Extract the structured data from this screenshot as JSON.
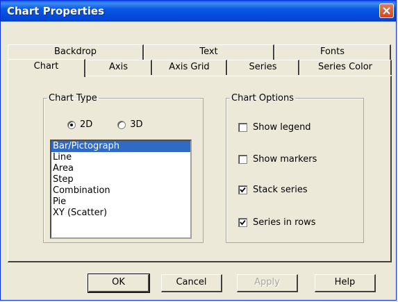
{
  "window": {
    "title": "Chart Properties"
  },
  "tabs_back": [
    "Backdrop",
    "Text",
    "Fonts"
  ],
  "tabs_front": [
    "Chart",
    "Axis",
    "Axis Grid",
    "Series",
    "Series Color"
  ],
  "active_tab": "Chart",
  "chart_type": {
    "legend": "Chart Type",
    "radio_2d": "2D",
    "radio_3d": "3D",
    "selected_dim": "2D",
    "items": [
      "Bar/Pictograph",
      "Line",
      "Area",
      "Step",
      "Combination",
      "Pie",
      "XY (Scatter)"
    ],
    "selected_item": "Bar/Pictograph"
  },
  "chart_options": {
    "legend": "Chart Options",
    "show_legend": {
      "label": "Show legend",
      "checked": false
    },
    "show_markers": {
      "label": "Show markers",
      "checked": false
    },
    "stack_series": {
      "label": "Stack series",
      "checked": true
    },
    "series_in_rows": {
      "label": "Series in rows",
      "checked": true
    }
  },
  "buttons": {
    "ok": "OK",
    "cancel": "Cancel",
    "apply": "Apply",
    "help": "Help"
  }
}
